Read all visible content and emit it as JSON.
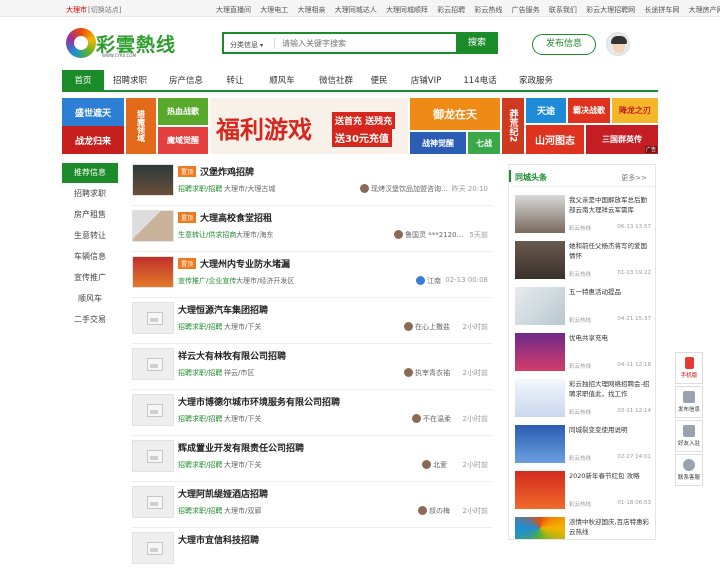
{
  "topbar": {
    "city": "大理市",
    "switch": "[切换站点]",
    "links": [
      "大理直播间",
      "大理电工",
      "大理相亲",
      "大理同城达人",
      "大理同城顺拜",
      "彩云招聘",
      "彩云热线",
      "广告服务",
      "联系我们",
      "彩云大理招聘网",
      "长途拼车网",
      "大理房产网"
    ]
  },
  "logo": {
    "text": "彩雲熱线",
    "sub": "WWW.CYRX.COM"
  },
  "search": {
    "category": "分类信息",
    "placeholder": "请输入关键字搜索",
    "button": "搜索"
  },
  "post_button": "发布信息",
  "nav": [
    "首页",
    "招聘求职",
    "房产信息",
    "转让",
    "顺风车",
    "微信社群",
    "便民",
    "店铺VIP",
    "114电话",
    "家政服务"
  ],
  "banners": {
    "b1": "盛世遮天",
    "b2": "战龙归来",
    "b3": "猎魔领域",
    "b4": "热血战歌",
    "b5": "魔域觉醒",
    "b6a": "福利游戏",
    "b6b": "送首充 送残充",
    "b6c": "送30元充值",
    "b7": "御龙在天",
    "b8": "战神觉醒",
    "b9": "七战",
    "b10": "莽荒纪2",
    "b11": "天途",
    "b12": "霸决战歌",
    "b13": "降龙之刃",
    "b14": "山河图志",
    "b15": "三国群英传",
    "ad": "广告"
  },
  "leftnav": {
    "head": "推荐信息",
    "items": [
      "招聘求职",
      "房产租售",
      "生意转让",
      "车辆信息",
      "宣传推广",
      "顺风车",
      "二手交易"
    ]
  },
  "listings": [
    {
      "top": "置顶",
      "title": "汉堡炸鸡招牌",
      "cat": "招聘求职/招聘",
      "loc": "大理市/大理古城",
      "user": "现烤汉堡饮品加盟咨询...",
      "time": "昨天 20:10"
    },
    {
      "top": "置顶",
      "title": "大理高校食堂招租",
      "cat": "生意转让/供求招商",
      "loc": "大理市/海东",
      "user": "鲁国灵 ***2120...",
      "time": "5天前"
    },
    {
      "top": "置顶",
      "title": "大理州内专业防水堵漏",
      "cat": "宣传推广/企业宣传",
      "loc": "大理市/经济开发区",
      "user": "江南",
      "time": "02-13 00:08"
    },
    {
      "top": "",
      "title": "大理恒源汽车集团招聘",
      "cat": "招聘求职/招聘",
      "loc": "大理市/下关",
      "user": "在心上撒盐",
      "time": "2小时前"
    },
    {
      "top": "",
      "title": "祥云大有林牧有限公司招聘",
      "cat": "招聘求职/招聘",
      "loc": "祥云/市区",
      "user": "执宰青衣袖",
      "time": "2小时前"
    },
    {
      "top": "",
      "title": "大理市博德尔城市环境服务有限公司招聘",
      "cat": "招聘求职/招聘",
      "loc": "大理市/下关",
      "user": "不在温柔",
      "time": "2小时前"
    },
    {
      "top": "",
      "title": "辉成置业开发有限责任公司招聘",
      "cat": "招聘求职/招聘",
      "loc": "大理市/下关",
      "user": "北爱",
      "time": "2小时前"
    },
    {
      "top": "",
      "title": "大理阿凯缇娅酒店招聘",
      "cat": "招聘求职/招聘",
      "loc": "大理市/双廊",
      "user": "叔の梅",
      "time": "2小时前"
    },
    {
      "top": "",
      "title": "大理市宜信科技招聘",
      "cat": "",
      "loc": "",
      "user": "",
      "time": ""
    }
  ],
  "sidebar": {
    "title": "同城头条",
    "more": "更多>>",
    "news": [
      {
        "title": "我父亲是中国解放军总后勤部云南大理祥云军需库",
        "source": "彩云热线",
        "date": "06-13 13:57"
      },
      {
        "title": "她和前任父杨杰将写的爱国情怀",
        "source": "彩云热线",
        "date": "01-13 19:22"
      },
      {
        "title": "五一特惠活动提品",
        "source": "彩云热线",
        "date": "04-21 15:37"
      },
      {
        "title": "优电共享充电",
        "source": "彩云热线",
        "date": "04-11 12:18"
      },
      {
        "title": "彩云独招大理网络招聘会-招聘求职值此，找工作",
        "source": "彩云热线",
        "date": "03-11 12:14"
      },
      {
        "title": "同城裂变变使用说明",
        "source": "彩云热线",
        "date": "02-27 14:01"
      },
      {
        "title": "2020新年春节红包 攻略",
        "source": "彩云热线",
        "date": "01-18 06:03"
      },
      {
        "title": "浓情中秋迎国庆,百店特惠彩云热线",
        "source": "",
        "date": ""
      }
    ]
  },
  "float_buttons": [
    "手机版",
    "发布信息",
    "好友入驻",
    "联系客服"
  ]
}
